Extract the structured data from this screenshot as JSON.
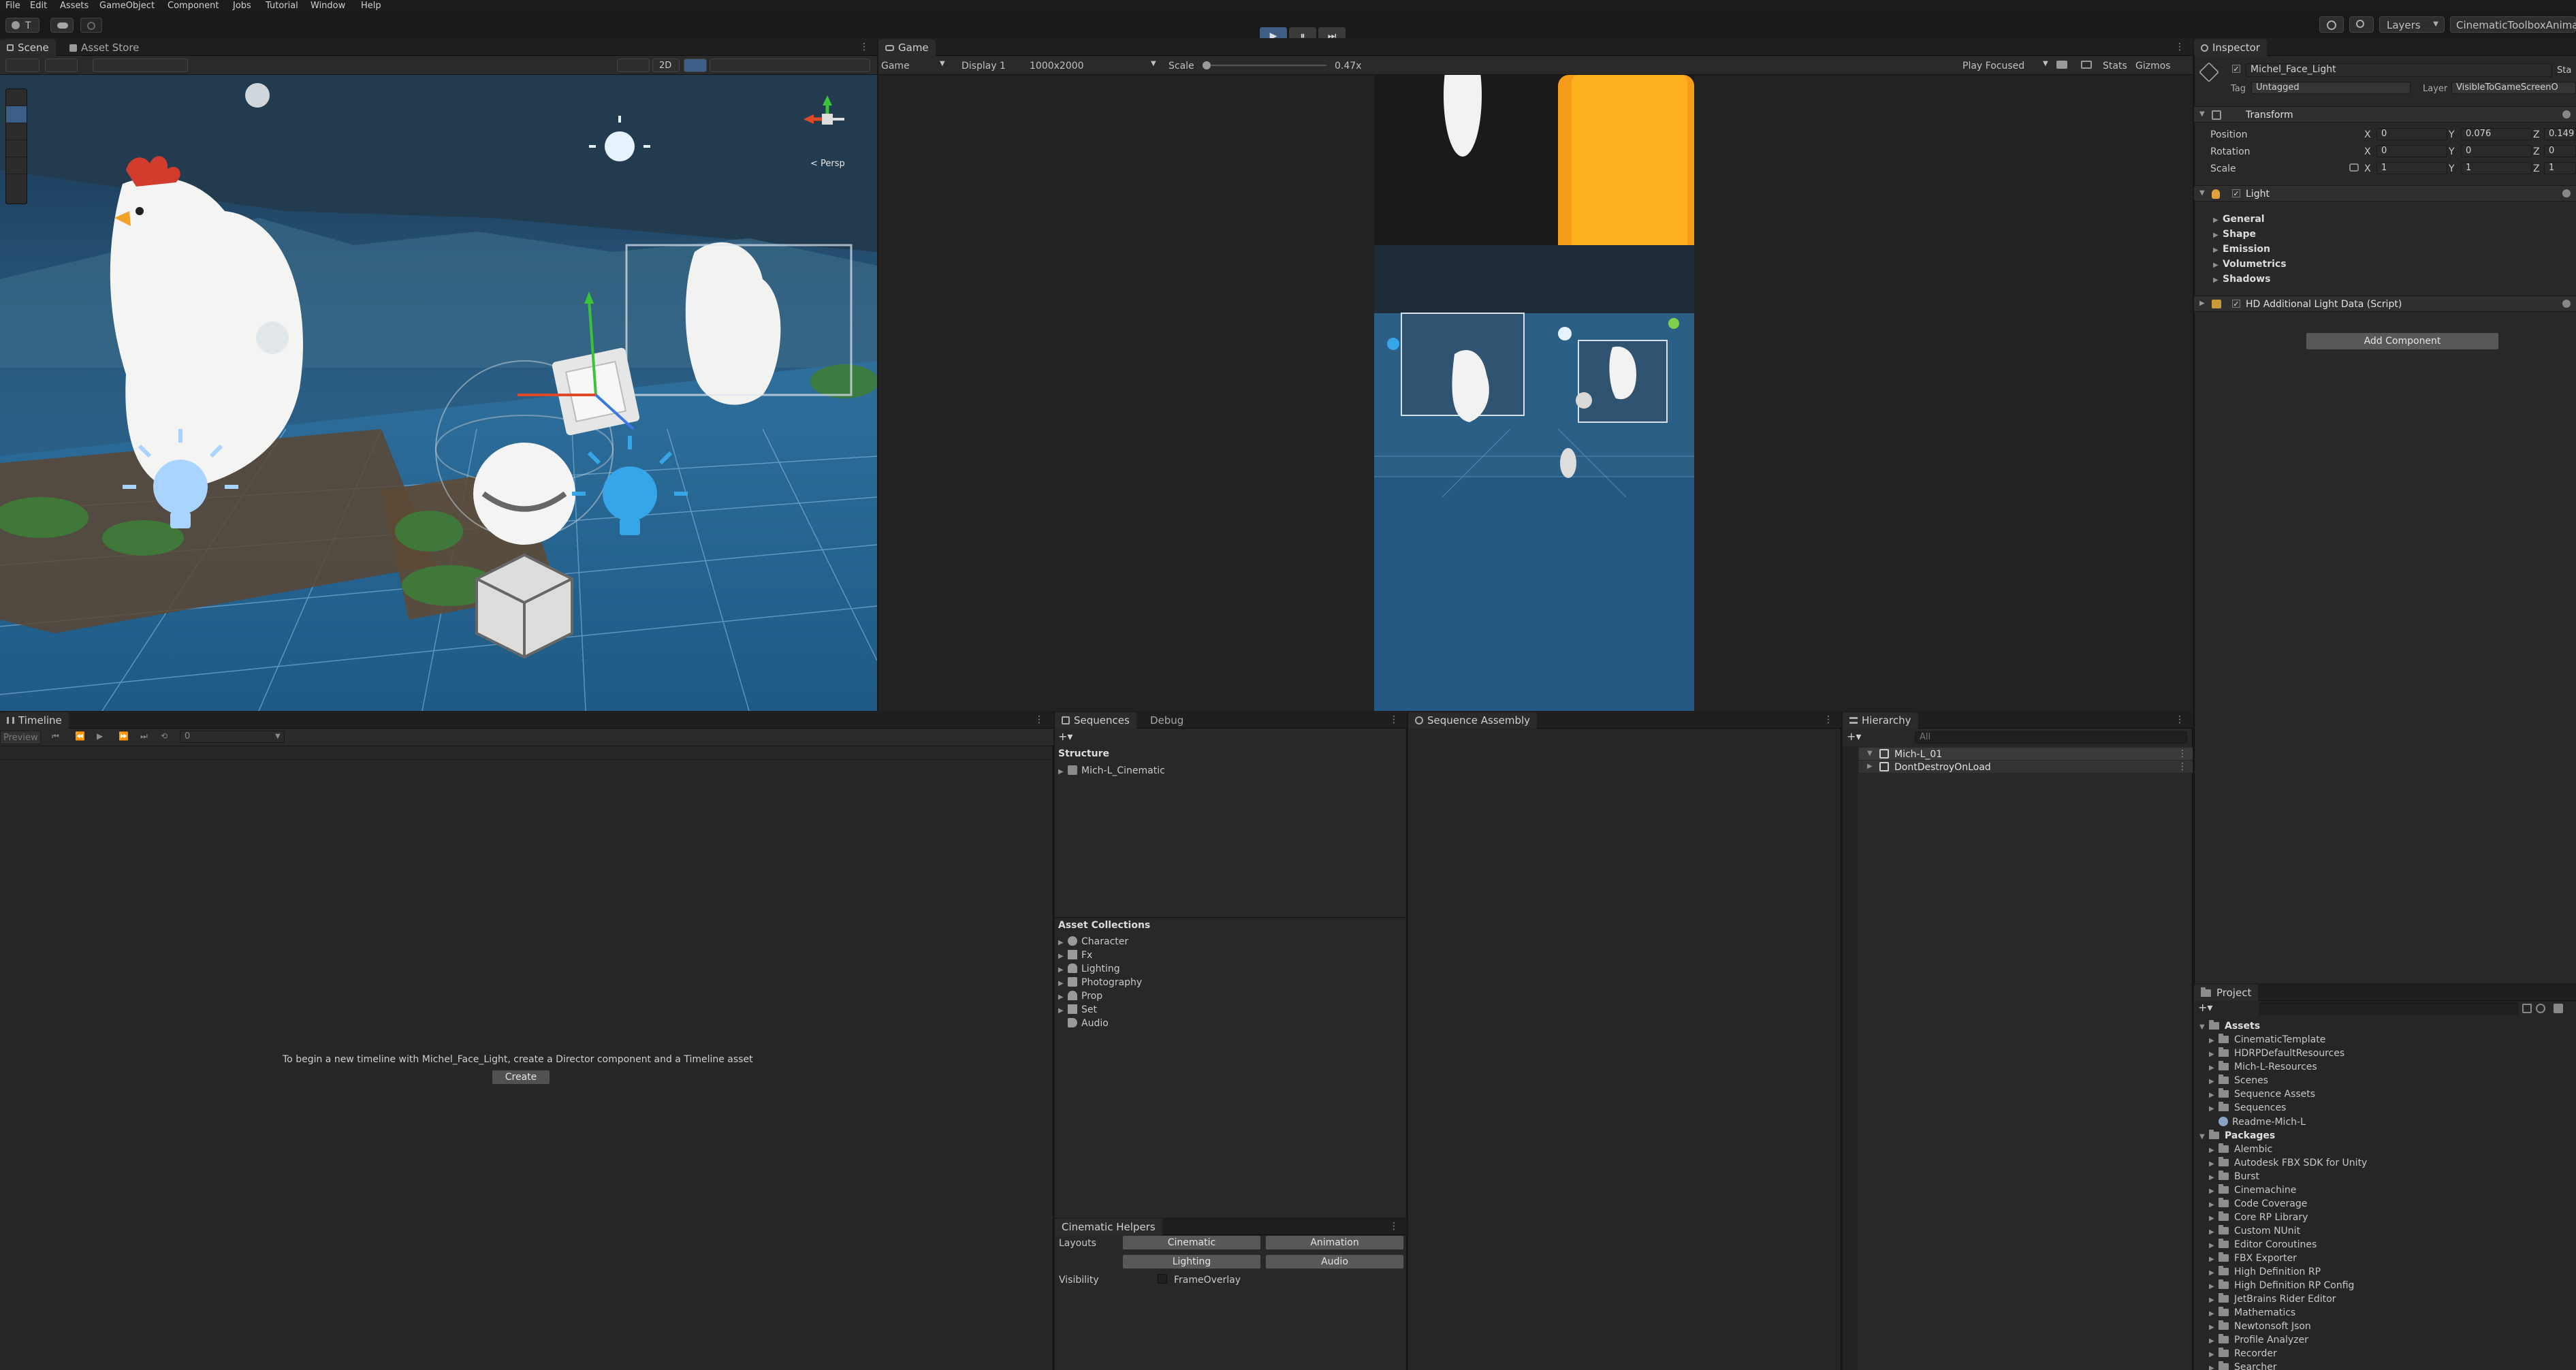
{
  "menu": [
    "File",
    "Edit",
    "Assets",
    "GameObject",
    "Component",
    "Jobs",
    "Tutorial",
    "Window",
    "Help"
  ],
  "toolbar": {
    "account_label": "T",
    "layers_label": "Layers",
    "layout_label": "CinematicToolboxAnimat",
    "play_icon": "▶",
    "pause_icon": "⏸",
    "step_icon": "⏭"
  },
  "scene": {
    "tabs": [
      "Scene",
      "Asset Store"
    ],
    "tool_2d": "2D",
    "persp_label": "< Persp"
  },
  "game": {
    "tab": "Game",
    "display_mode": "Game",
    "display": "Display 1",
    "resolution": "1000x2000",
    "scale_label": "Scale",
    "scale_value": "0.47x",
    "play_focused": "Play Focused",
    "stats": "Stats",
    "gizmos": "Gizmos"
  },
  "inspector": {
    "tab": "Inspector",
    "object_name": "Michel_Face_Light",
    "static_label": "Sta",
    "tag_label": "Tag",
    "tag_value": "Untagged",
    "layer_label": "Layer",
    "layer_value": "VisibleToGameScreenO",
    "transform": {
      "title": "Transform",
      "position_label": "Position",
      "rotation_label": "Rotation",
      "scale_label": "Scale",
      "pos": [
        "0",
        "0.076",
        "0.149"
      ],
      "rot": [
        "0",
        "0",
        "0"
      ],
      "scl": [
        "1",
        "1",
        "1"
      ],
      "axes": [
        "X",
        "Y",
        "Z"
      ]
    },
    "light": {
      "title": "Light",
      "sections": [
        "General",
        "Shape",
        "Emission",
        "Volumetrics",
        "Shadows"
      ]
    },
    "hd_script": "HD Additional Light Data (Script)",
    "add_component": "Add Component"
  },
  "timeline": {
    "tab": "Timeline",
    "preview": "Preview",
    "frame": "0",
    "message": "To begin a new timeline with Michel_Face_Light, create a Director component and a Timeline asset",
    "create": "Create"
  },
  "sequences": {
    "tabs": [
      "Sequences",
      "Debug"
    ],
    "structure": "Structure",
    "items": [
      "Mich-L_Cinematic"
    ],
    "asset_collections": "Asset Collections",
    "collections": [
      "Character",
      "Fx",
      "Lighting",
      "Photography",
      "Prop",
      "Set",
      "Audio"
    ]
  },
  "cinematic_helpers": {
    "title": "Cinematic Helpers",
    "layouts_label": "Layouts",
    "buttons": [
      "Cinematic",
      "Animation",
      "Lighting",
      "Audio"
    ],
    "visibility_label": "Visibility",
    "frame_overlay": "FrameOverlay"
  },
  "sequence_assembly": {
    "tab": "Sequence Assembly"
  },
  "hierarchy": {
    "tab": "Hierarchy",
    "search_placeholder": "All",
    "items": [
      "Mich-L_01",
      "DontDestroyOnLoad"
    ]
  },
  "project": {
    "tab": "Project",
    "assets_label": "Assets",
    "assets": [
      "CinematicTemplate",
      "HDRPDefaultResources",
      "Mich-L-Resources",
      "Scenes",
      "Sequence Assets",
      "Sequences",
      "Readme-Mich-L"
    ],
    "packages_label": "Packages",
    "packages": [
      "Alembic",
      "Autodesk FBX SDK for Unity",
      "Burst",
      "Cinemachine",
      "Code Coverage",
      "Core RP Library",
      "Custom NUnit",
      "Editor Coroutines",
      "FBX Exporter",
      "High Definition RP",
      "High Definition RP Config",
      "JetBrains Rider Editor",
      "Mathematics",
      "Newtonsoft Json",
      "Profile Analyzer",
      "Recorder",
      "Searcher"
    ]
  }
}
